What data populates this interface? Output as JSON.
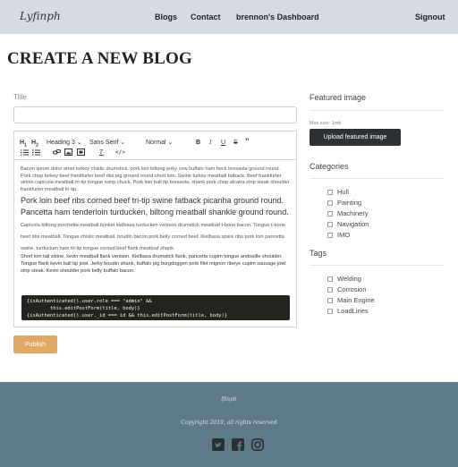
{
  "nav": {
    "brand": "Lyfinph",
    "links": [
      "Blogs",
      "Contact",
      "brennon's Dashboard"
    ],
    "signout": "Signout"
  },
  "page": {
    "title": "CREATE A NEW BLOG"
  },
  "form": {
    "title_label": "Title",
    "title_value": "",
    "publish_label": "Publish"
  },
  "toolbar": {
    "heading_select": "Heading 3",
    "font_select": "Sans Serif",
    "size_select": "Normal",
    "icons": [
      "h1-icon",
      "h2-icon",
      "bold-icon",
      "italic-icon",
      "underline-icon",
      "strike-icon",
      "quote-icon",
      "ordered-list-icon",
      "bullet-list-icon",
      "link-icon",
      "image-icon",
      "video-icon",
      "clear-format-icon",
      "code-icon"
    ]
  },
  "editor": {
    "para1": "Bacon ipsum dolor amet turkey chislic drumstick, pork loin biltong jerky cow buffalo ham hock bresaola ground round. Pork chop turkey beef frankfurter beef ribs pig ground round short loin. Swine turkey meatball fatback. Beef frankfurter sirloin capicola meatball tri-tip tongue rump chuck. Pork loin ball tip bresaola, shank pork chop alcatra strip steak shoulder frankfurter meatball tri-tip.",
    "para2_big": "Pork loin beef ribs corned beef tri-tip swine fatback picanha ground round. Pancetta ham tenderloin turducken, biltong meatball shankle ground round.",
    "para2_small": " Capicola biltong porchetta meatball brisket kielbasa turducken venison drumstick meatloaf t-bone bacon. Tongue t-bone beef ribs meatball. Tongue chislic meatball, boudin bacon pork belly corned beef. Kielbasa spare ribs pork loin pancetta swine, turducken ham tri-tip tongue corned beef flank meatloaf shank.",
    "para3": "Short loin tail swine, kevin meatball flank venison. Kielbasa drumstick flank, pancetta cupim tongue andouille shoulder. Tongue flank kevin ball tip jowl. Jerky boudin shank, buffalo pig burgdoggen pork filet mignon ribeye cupim sausage jowl strip steak. Kevin shoulder pork belly buffalo bacon.",
    "code_line1": "{isAuthenticated().user.role === \"admin\" &&",
    "code_line2": "        this.editPostForm(title, body)}",
    "code_line3": "{isAuthenticated().user._id === id && this.editPostForm(title, body)}"
  },
  "sidebar": {
    "featured_heading": "Featured image",
    "max_size": "Max size: 1mb",
    "upload_label": "Upload featured image",
    "categories_heading": "Categories",
    "categories": [
      "Hull",
      "Painting",
      "Machinery",
      "Navigation",
      "IMO"
    ],
    "tags_heading": "Tags",
    "tags": [
      "Welding",
      "Corrosion",
      "Main Engine",
      "LoadLines"
    ]
  },
  "footer": {
    "brand": "lfinph",
    "copyright": "Copyright 2019, all rights reserved",
    "social_icons": [
      "twitter-icon",
      "facebook-icon",
      "instagram-icon"
    ]
  }
}
